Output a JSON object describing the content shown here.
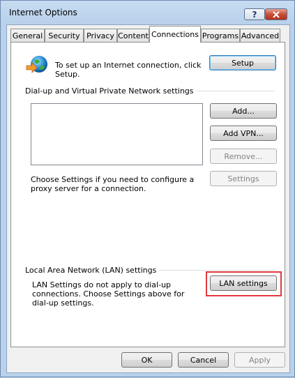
{
  "window": {
    "title": "Internet Options",
    "help_label": "?",
    "close_label": "X"
  },
  "tabs": [
    {
      "label": "General"
    },
    {
      "label": "Security"
    },
    {
      "label": "Privacy"
    },
    {
      "label": "Content"
    },
    {
      "label": "Connections",
      "selected": true
    },
    {
      "label": "Programs"
    },
    {
      "label": "Advanced"
    }
  ],
  "setup": {
    "text": "To set up an Internet connection, click Setup.",
    "button": "Setup"
  },
  "dialup": {
    "heading": "Dial-up and Virtual Private Network settings",
    "add": "Add...",
    "add_vpn": "Add VPN...",
    "remove": "Remove...",
    "settings": "Settings",
    "proxy_text": "Choose Settings if you need to configure a proxy server for a connection."
  },
  "lan": {
    "heading": "Local Area Network (LAN) settings",
    "text": "LAN Settings do not apply to dial-up connections. Choose Settings above for dial-up settings.",
    "button": "LAN settings"
  },
  "footer": {
    "ok": "OK",
    "cancel": "Cancel",
    "apply": "Apply"
  },
  "colors": {
    "annotation": "#e0393e",
    "accent": "#3c7fb1"
  },
  "icons": {
    "globe": "globe-connect-icon",
    "arrow": "annotation-arrow"
  }
}
